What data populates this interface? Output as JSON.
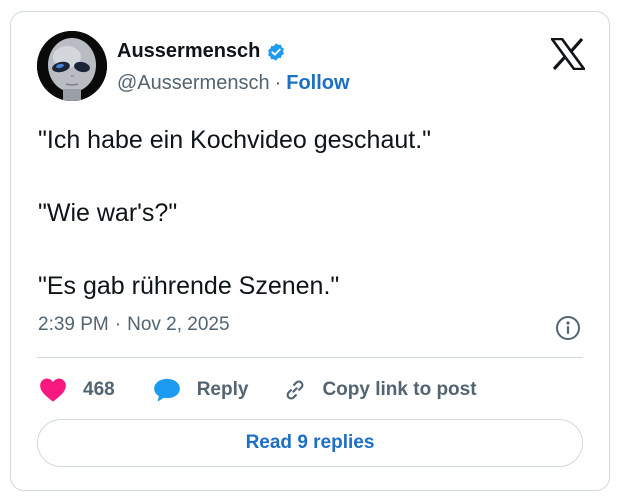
{
  "author": {
    "display_name": "Aussermensch",
    "handle": "@Aussermensch",
    "separator": "·",
    "follow_label": "Follow",
    "verified_icon": "verified-badge-icon"
  },
  "brand": {
    "logo": "x-logo-icon"
  },
  "tweet": {
    "lines": [
      "\"Ich habe ein Kochvideo geschaut.\"",
      "\"Wie war's?\"",
      "\"Es gab rührende Szenen.\""
    ]
  },
  "meta": {
    "time": "2:39 PM",
    "separator": "·",
    "date": "Nov 2, 2025",
    "info_icon": "info-icon"
  },
  "actions": {
    "like_count": "468",
    "reply_label": "Reply",
    "copy_label": "Copy link to post"
  },
  "footer": {
    "read_replies_label": "Read 9 replies"
  },
  "colors": {
    "accent": "#1d6fc6",
    "verified": "#1d9bf0",
    "like": "#f91880",
    "reply": "#1d9bf0",
    "muted_text": "#536471",
    "border": "#cfd9de"
  }
}
